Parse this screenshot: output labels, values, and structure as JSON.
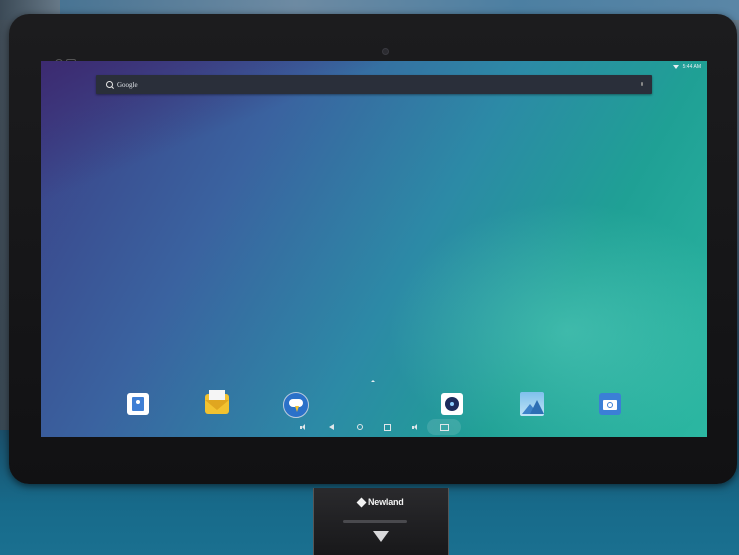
{
  "device": {
    "brand": "Newland"
  },
  "statusbar": {
    "time": "5:44 AM",
    "wifi_icon": "wifi-icon"
  },
  "search": {
    "label": "Google",
    "icon": "search-icon"
  },
  "dock": {
    "apps": [
      {
        "name": "contacts-app-icon"
      },
      {
        "name": "email-app-icon"
      },
      {
        "name": "weather-app-icon"
      },
      {
        "name": "camera-lens-app-icon"
      },
      {
        "name": "gallery-app-icon"
      },
      {
        "name": "camera-app-icon"
      }
    ]
  },
  "navbar": {
    "buttons": [
      "volume-down-icon",
      "back-icon",
      "home-icon",
      "recents-icon",
      "volume-up-icon",
      "screenshot-icon"
    ]
  },
  "colors": {
    "wallpaper_start": "#3b3f86",
    "wallpaper_end": "#2cb8a2",
    "search_bg": "#2a2f3a",
    "bezel": "#1c1c1e"
  }
}
